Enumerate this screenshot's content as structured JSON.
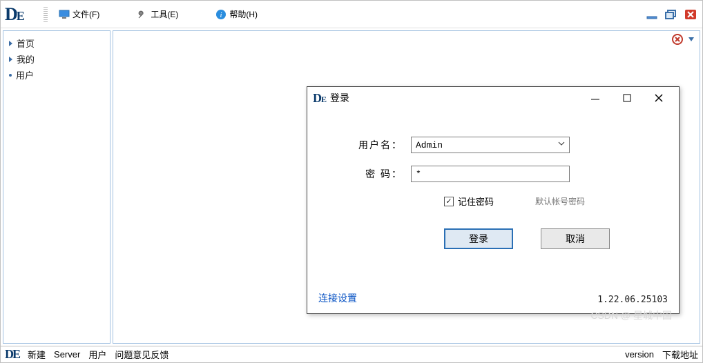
{
  "menubar": {
    "file": "文件(F)",
    "tools": "工具(E)",
    "help": "帮助(H)"
  },
  "sidebar": {
    "items": [
      {
        "label": "首页",
        "style": "tri"
      },
      {
        "label": "我的",
        "style": "tri"
      },
      {
        "label": "用户",
        "style": "dot"
      }
    ]
  },
  "login_dialog": {
    "title": "登录",
    "username_label": "用户名：",
    "username_value": "Admin",
    "password_label": "密  码：",
    "password_value": "*",
    "remember_label": "记住密码",
    "remember_checked": true,
    "hint": "默认帐号密码",
    "login_btn": "登录",
    "cancel_btn": "取消",
    "link": "连接设置",
    "version": "1.22.06.25103"
  },
  "statusbar": {
    "new": "新建",
    "server": "Server",
    "user": "用户",
    "feedback": "问题意见反馈",
    "version_label": "version",
    "download": "下载地址"
  },
  "watermark": "CSDN @ 星城中国"
}
